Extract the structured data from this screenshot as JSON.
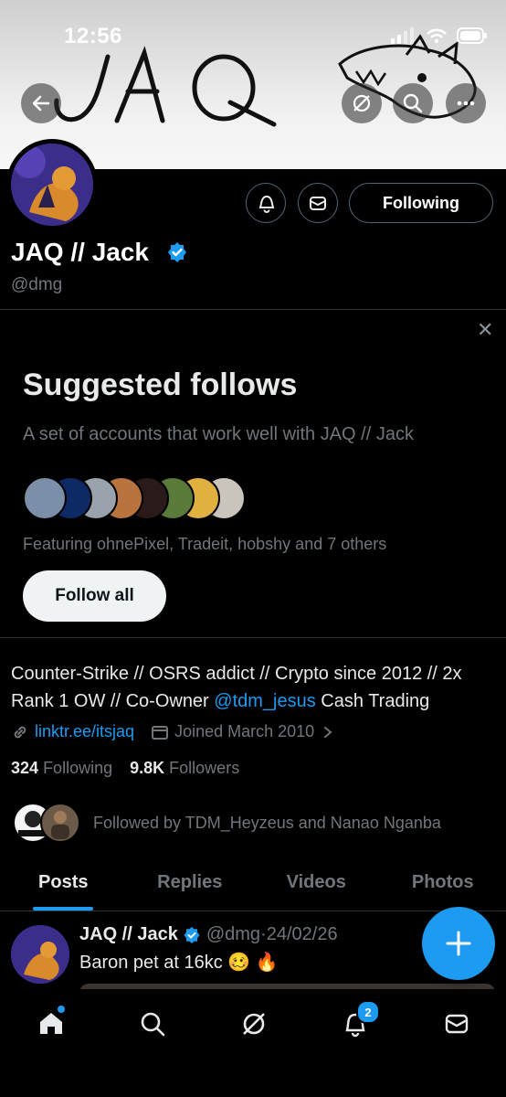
{
  "status_bar": {
    "time": "12:56"
  },
  "banner": {
    "handwritten_text": "JAQ"
  },
  "profile": {
    "display_name": "JAQ // Jack",
    "handle": "@dmg",
    "following_button": "Following"
  },
  "suggested": {
    "title": "Suggested follows",
    "subtitle": "A set of accounts that work well with JAQ // Jack",
    "featuring": "Featuring ohnePixel, Tradeit, hobshy and 7 others",
    "follow_all": "Follow all",
    "avatar_colors": [
      "#7b8fa8",
      "#0e2a66",
      "#9aa3ad",
      "#b8733f",
      "#2a1a1a",
      "#5a7a3a",
      "#e0b040",
      "#c9c4bc"
    ]
  },
  "bio": {
    "text_before": "Counter-Strike // OSRS addict // Crypto since 2012 // 2x Rank 1 OW // Co-Owner ",
    "mention": "@tdm_jesus",
    "text_after": " Cash Trading",
    "link": "linktr.ee/itsjaq",
    "joined": "Joined March 2010"
  },
  "stats": {
    "following_count": "324",
    "following_label": "Following",
    "followers_count": "9.8K",
    "followers_label": "Followers"
  },
  "followed_by": {
    "text": "Followed by TDM_Heyzeus and Nanao Nganba"
  },
  "tabs": [
    {
      "label": "Posts",
      "active": true
    },
    {
      "label": "Replies"
    },
    {
      "label": "Videos"
    },
    {
      "label": "Photos"
    }
  ],
  "post": {
    "name": "JAQ // Jack",
    "handle": "@dmg",
    "dot": "·",
    "date": "24/02/26",
    "text": "Baron pet at 16kc 🥴 🔥"
  },
  "nav": {
    "notification_count": "2",
    "icons": [
      "home-icon",
      "search-icon",
      "grok-icon",
      "bell-icon",
      "mail-icon"
    ]
  },
  "colors": {
    "accent": "#1d9bf0",
    "background": "#000000",
    "muted": "#71767b"
  }
}
